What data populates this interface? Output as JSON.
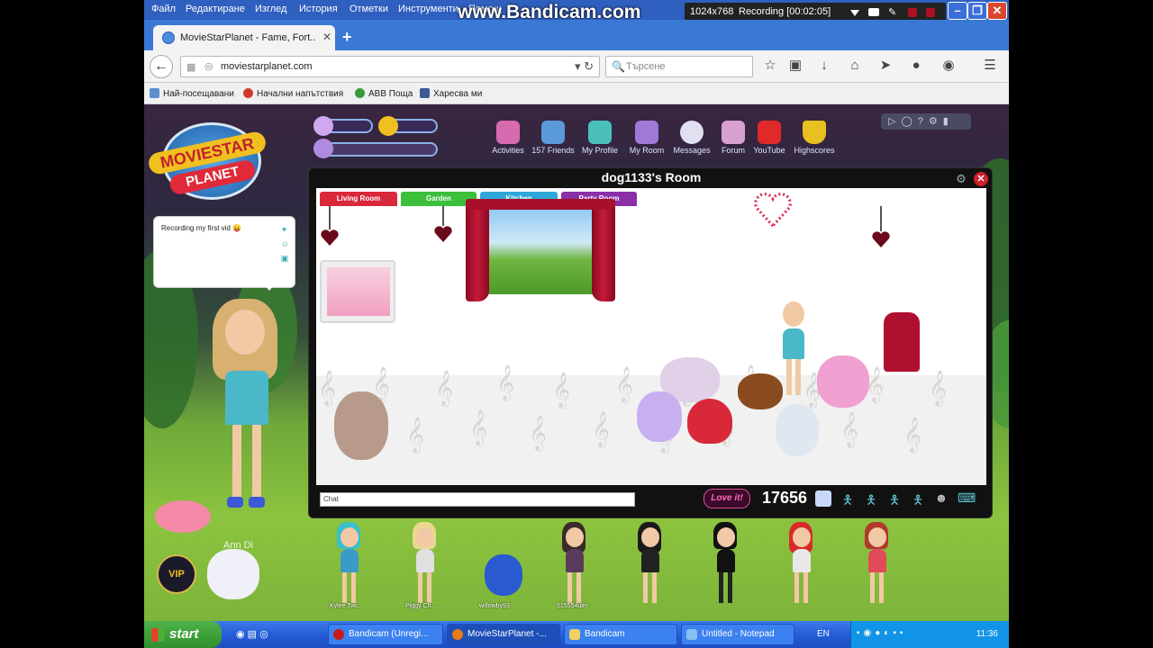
{
  "menu": [
    "Файл",
    "Редактиране",
    "Изглед",
    "История",
    "Отметки",
    "Инструменти",
    "Помощ"
  ],
  "bandicam": {
    "watermark": "www.Bandicam.com",
    "resolution": "1024x768",
    "recording": "Recording [00:02:05]"
  },
  "browser": {
    "tab_title": "MovieStarPlanet - Fame, Fort...",
    "url": "moviestarplanet.com",
    "search_placeholder": "Търсене",
    "bookmarks": [
      "Най-посещавани",
      "Начални напътствия",
      "ABB Поща",
      "Харесва ми"
    ]
  },
  "game": {
    "logo_line1": "MOVIESTAR",
    "logo_line2": "PLANET",
    "nav": [
      "Activities",
      "157 Friends",
      "My Profile",
      "My Room",
      "Messages",
      "Forum",
      "YouTube",
      "Highscores"
    ],
    "chat_bubble": "Recording my first vid 😛",
    "player_name": "Ann Di",
    "vip_label": "VIP",
    "friends_names": [
      "Kylee Twi...",
      "Piggy Ch...",
      "willowby93",
      "515554ulm",
      "...",
      "...",
      "...",
      "..."
    ]
  },
  "room": {
    "title": "dog1133's Room",
    "tabs": [
      "Living Room",
      "Garden",
      "Kitchen",
      "Party Room"
    ],
    "chat_placeholder": "Chat",
    "love_it": "Love it!",
    "love_count": "17656"
  },
  "taskbar": {
    "start": "start",
    "tasks": [
      "Bandicam (Unregi...",
      "MovieStarPlanet -...",
      "Bandicam",
      "Untitled - Notepad"
    ],
    "lang": "EN",
    "clock": "11:36"
  },
  "colors": {
    "titlebar": "#2f5fbf",
    "room_tab_living": "#d9283a",
    "room_tab_garden": "#3cbf3a",
    "room_tab_kitchen": "#2fa8d9",
    "room_tab_party": "#8b2fa8",
    "taskbar": "#245ed8"
  }
}
